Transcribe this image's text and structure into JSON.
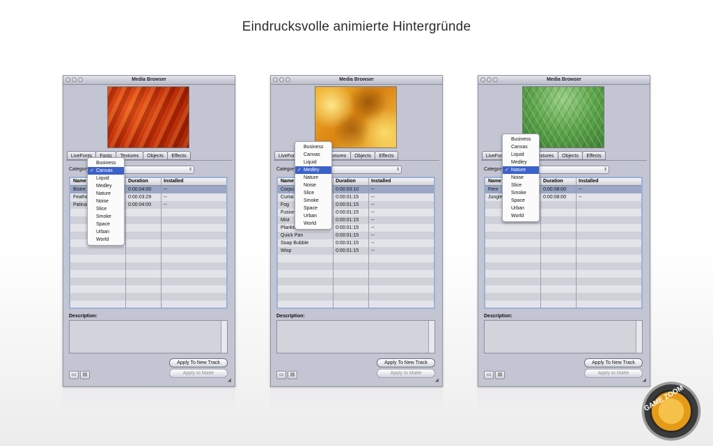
{
  "headline": "Eindrucksvolle animierte Hintergründe",
  "window_title": "Media Browser",
  "tabs": [
    "LiveFonts",
    "Fonts",
    "Textures",
    "Objects",
    "Effects"
  ],
  "category_label": "Category:",
  "columns": [
    "Name",
    "Duration",
    "Installed"
  ],
  "description_label": "Description:",
  "apply_new_track": "Apply To New Track",
  "apply_matte": "Apply to Matte",
  "menu_items": [
    "Business",
    "Canvas",
    "Liquid",
    "Medley",
    "Nature",
    "Noise",
    "Slice",
    "Smoke",
    "Space",
    "Urban",
    "World"
  ],
  "check_mark": "✓",
  "colors": {
    "selection": "#3c61c9",
    "window_bg": "#c3c5d2"
  },
  "windows": [
    {
      "selected_category": "Canvas",
      "preview": "red-canvas",
      "rows": [
        {
          "name": "Bistre",
          "duration": "0:00:04:00",
          "installed": "--"
        },
        {
          "name": "Feathe",
          "duration": "0:00:03:29",
          "installed": "--"
        },
        {
          "name": "Patina",
          "duration": "0:00:04:00",
          "installed": "--"
        }
      ]
    },
    {
      "selected_category": "Medley",
      "preview": "orange-medley",
      "rows": [
        {
          "name": "Corpu",
          "duration": "0:00:03:10",
          "installed": "--"
        },
        {
          "name": "Curtai",
          "duration": "0:00:01:15",
          "installed": "--"
        },
        {
          "name": "Fog",
          "duration": "0:00:01:15",
          "installed": "--"
        },
        {
          "name": "Fusion",
          "duration": "0:00:01:15",
          "installed": "--"
        },
        {
          "name": "Mist",
          "duration": "0:00:01:15",
          "installed": "--"
        },
        {
          "name": "Plankton",
          "duration": "0:00:01:15",
          "installed": "--"
        },
        {
          "name": "Quick Pan",
          "duration": "0:00:01:15",
          "installed": "--"
        },
        {
          "name": "Soap Bubble",
          "duration": "0:00:01:15",
          "installed": "--"
        },
        {
          "name": "Wisp",
          "duration": "0:00:01:15",
          "installed": "--"
        }
      ]
    },
    {
      "selected_category": "Nature",
      "preview": "green-nature",
      "rows": [
        {
          "name": "Fern",
          "duration": "0:00:08:00",
          "installed": "--"
        },
        {
          "name": "Jungle",
          "duration": "0:00:08:00",
          "installed": "--"
        }
      ]
    }
  ],
  "logo_text": "GAME ZOOM"
}
